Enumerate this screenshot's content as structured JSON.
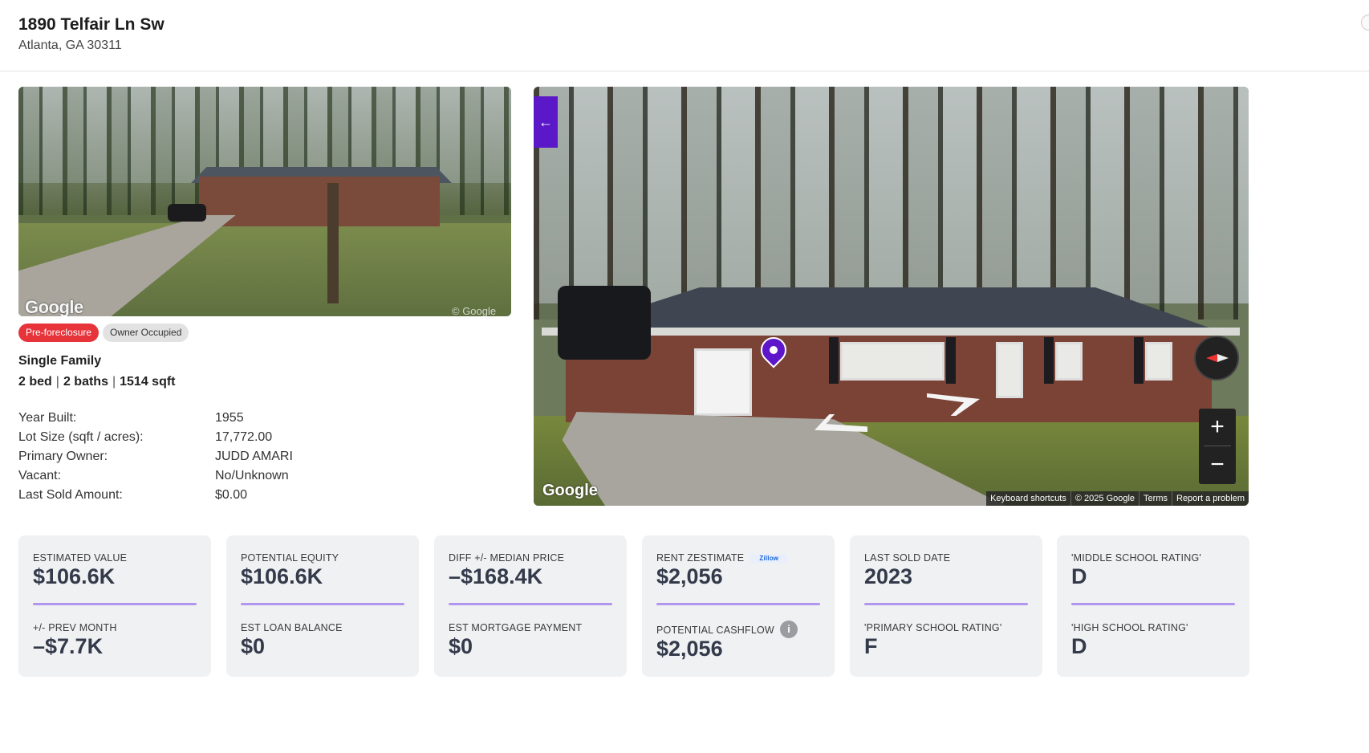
{
  "header": {
    "address_line1": "1890 Telfair Ln Sw",
    "address_line2": "Atlanta, GA 30311"
  },
  "photo": {
    "watermark": "Google",
    "copyright": "© Google"
  },
  "badges": {
    "status": "Pre-foreclosure",
    "occupancy": "Owner Occupied"
  },
  "property": {
    "type": "Single Family",
    "beds": "2 bed",
    "baths": "2 baths",
    "sqft": "1514 sqft",
    "separator": "|"
  },
  "facts": [
    {
      "label": "Year Built:",
      "value": "1955"
    },
    {
      "label": "Lot Size (sqft / acres):",
      "value": "17,772.00"
    },
    {
      "label": "Primary Owner:",
      "value": "JUDD AMARI"
    },
    {
      "label": "Vacant:",
      "value": "No/Unknown"
    },
    {
      "label": "Last Sold Amount:",
      "value": "$0.00"
    }
  ],
  "streetview": {
    "back_label": "←",
    "zoom_in": "+",
    "zoom_out": "−",
    "google_logo": "Google",
    "attribution": [
      "Keyboard shortcuts",
      "© 2025 Google",
      "Terms",
      "Report a problem"
    ]
  },
  "stats": [
    {
      "label1": "ESTIMATED VALUE",
      "value1": "$106.6K",
      "label2": "+/- PREV MONTH",
      "value2": "–$7.7K"
    },
    {
      "label1": "POTENTIAL EQUITY",
      "value1": "$106.6K",
      "label2": "EST LOAN BALANCE",
      "value2": "$0"
    },
    {
      "label1": "DIFF +/- MEDIAN PRICE",
      "value1": "–$168.4K",
      "label2": "EST MORTGAGE PAYMENT",
      "value2": "$0"
    },
    {
      "label1": "RENT ZESTIMATE",
      "value1": "$2,056",
      "label2": "POTENTIAL CASHFLOW",
      "value2": "$2,056",
      "logo": "Zillow",
      "info": "i"
    },
    {
      "label1": "LAST SOLD DATE",
      "value1": "2023",
      "label2": "'PRIMARY SCHOOL RATING'",
      "value2": "F"
    },
    {
      "label1": "'MIDDLE SCHOOL RATING'",
      "value1": "D",
      "label2": "'HIGH SCHOOL RATING'",
      "value2": "D"
    }
  ],
  "colors": {
    "badge_red": "#e7333a",
    "accent_purple": "#5a18c8",
    "bar_lavender": "#b196f0"
  }
}
